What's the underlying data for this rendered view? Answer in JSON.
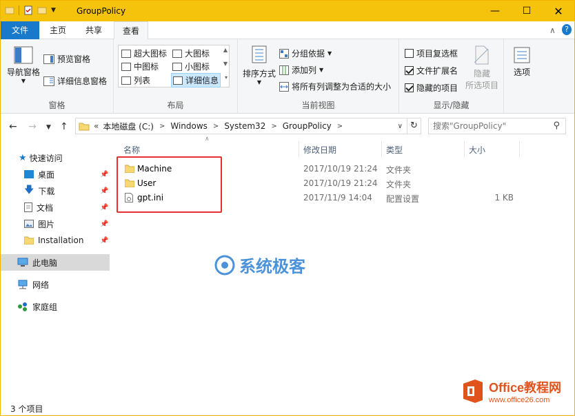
{
  "window": {
    "title": "GroupPolicy"
  },
  "tabs": [
    {
      "label": "文件"
    },
    {
      "label": "主页"
    },
    {
      "label": "共享"
    },
    {
      "label": "查看"
    }
  ],
  "ribbon": {
    "pane": {
      "nav_pane": "导航窗格",
      "preview": "预览窗格",
      "details": "详细信息窗格",
      "group": "窗格"
    },
    "layout": {
      "xl_icons": "超大图标",
      "large_icons": "大图标",
      "medium_icons": "中图标",
      "small_icons": "小图标",
      "list": "列表",
      "details": "详细信息",
      "group": "布局"
    },
    "current_view": {
      "sort_by": "排序方式",
      "group_by": "分组依据",
      "add_columns": "添加列",
      "fit_columns": "将所有列调整为合适的大小",
      "group": "当前视图"
    },
    "show_hide": {
      "item_checkboxes": "项目复选框",
      "file_extensions": "文件扩展名",
      "hidden_items": "隐藏的项目",
      "hide": "隐藏",
      "selected_items": "所选项目",
      "group": "显示/隐藏"
    },
    "options": "选项"
  },
  "address": {
    "prefix": "«",
    "crumbs": [
      "本地磁盘 (C:)",
      "Windows",
      "System32",
      "GroupPolicy"
    ]
  },
  "search": {
    "placeholder": "搜索\"GroupPolicy\""
  },
  "nav": {
    "quick_access": "快速访问",
    "desktop": "桌面",
    "downloads": "下载",
    "documents": "文档",
    "pictures": "图片",
    "installation": "Installation",
    "this_pc": "此电脑",
    "network": "网络",
    "homegroup": "家庭组"
  },
  "columns": {
    "name": "名称",
    "date": "修改日期",
    "type": "类型",
    "size": "大小"
  },
  "files": [
    {
      "name": "Machine",
      "date": "2017/10/19 21:24",
      "type": "文件夹",
      "size": ""
    },
    {
      "name": "User",
      "date": "2017/10/19 21:24",
      "type": "文件夹",
      "size": ""
    },
    {
      "name": "gpt.ini",
      "date": "2017/11/9 14:04",
      "type": "配置设置",
      "size": "1 KB"
    }
  ],
  "status": {
    "count": "3 个项目"
  },
  "watermark": {
    "text": "系统极客"
  },
  "logo": {
    "title": "Office教程网",
    "url": "www.office26.com"
  },
  "colors": {
    "titlebar": "#f6c30c",
    "file_tab": "#1979ca",
    "highlight": "#e53030"
  }
}
